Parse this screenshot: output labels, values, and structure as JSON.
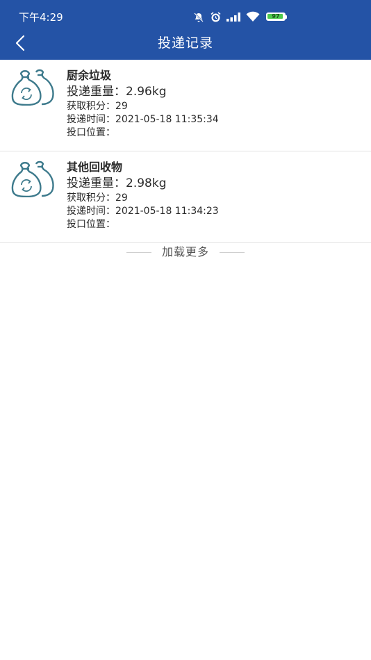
{
  "status_bar": {
    "time": "下午4:29",
    "battery_level": "97",
    "battery_percent": 97,
    "icons": [
      "bell-mute-icon",
      "alarm-icon",
      "signal-icon",
      "wifi-icon",
      "battery-icon"
    ]
  },
  "header": {
    "title": "投递记录",
    "back_icon": "chevron-left-icon",
    "background_color": "#2453a6"
  },
  "records": [
    {
      "category": "厨余垃圾",
      "weight": "投递重量：2.96kg",
      "points": "获取积分：29",
      "time": "投递时间：2021-05-18 11:35:34",
      "location": "投口位置：",
      "icon": "garbage-bag-icon"
    },
    {
      "category": "其他回收物",
      "weight": "投递重量：2.98kg",
      "points": "获取积分：29",
      "time": "投递时间：2021-05-18 11:34:23",
      "location": "投口位置：",
      "icon": "garbage-bag-icon"
    }
  ],
  "load_more": {
    "label": "加载更多"
  },
  "colors": {
    "icon_stroke": "#3d7a8c",
    "divider": "#e3e3e3",
    "battery_green": "#4cc94c"
  }
}
